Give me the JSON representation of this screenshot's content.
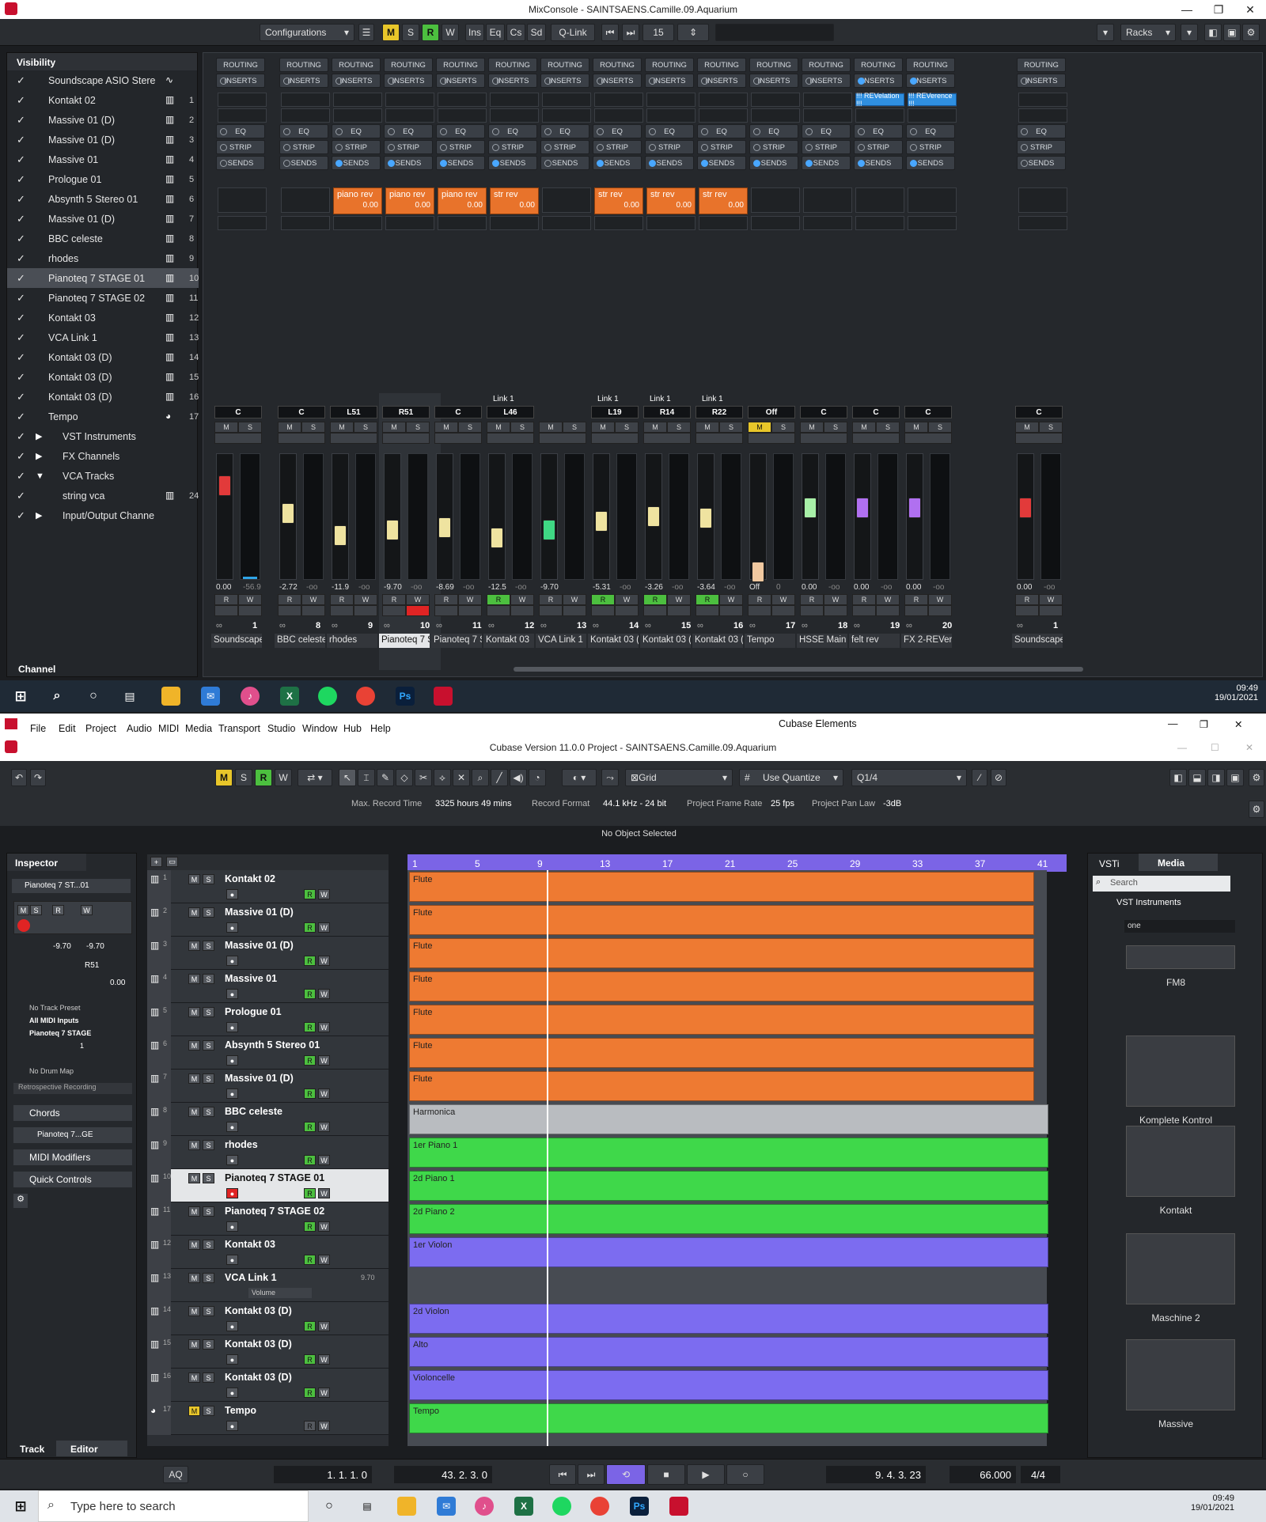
{
  "mixwin": {
    "title": "MixConsole - SAINTSAENS.Camille.09.Aquarium",
    "toolbar": {
      "configurations": "Configurations",
      "m": "M",
      "s": "S",
      "r": "R",
      "w": "W",
      "ins": "Ins",
      "eq": "Eq",
      "cs": "Cs",
      "sd": "Sd",
      "qlink": "Q-Link",
      "count": "15",
      "racks": "Racks"
    },
    "visibility_title": "Visibility",
    "channel_tab": "Channel",
    "visibility": [
      {
        "name": "Soundscape ASIO Stere",
        "num": ""
      },
      {
        "name": "Kontakt 02",
        "num": "1"
      },
      {
        "name": "Massive 01 (D)",
        "num": "2"
      },
      {
        "name": "Massive 01 (D)",
        "num": "3"
      },
      {
        "name": "Massive 01",
        "num": "4"
      },
      {
        "name": "Prologue 01",
        "num": "5"
      },
      {
        "name": "Absynth 5 Stereo 01",
        "num": "6"
      },
      {
        "name": "Massive 01 (D)",
        "num": "7"
      },
      {
        "name": "BBC celeste",
        "num": "8"
      },
      {
        "name": "rhodes",
        "num": "9"
      },
      {
        "name": "Pianoteq 7 STAGE 01",
        "num": "10"
      },
      {
        "name": "Pianoteq 7 STAGE 02",
        "num": "11"
      },
      {
        "name": "Kontakt 03",
        "num": "12"
      },
      {
        "name": "VCA Link 1",
        "num": "13"
      },
      {
        "name": "Kontakt 03 (D)",
        "num": "14"
      },
      {
        "name": "Kontakt 03 (D)",
        "num": "15"
      },
      {
        "name": "Kontakt 03 (D)",
        "num": "16"
      },
      {
        "name": "Tempo",
        "num": "17"
      },
      {
        "name": "VST Instruments",
        "num": ""
      },
      {
        "name": "FX Channels",
        "num": ""
      },
      {
        "name": "VCA Tracks",
        "num": ""
      },
      {
        "name": "string vca",
        "num": "24"
      },
      {
        "name": "Input/Output Channe",
        "num": ""
      }
    ],
    "rack_labels": {
      "routing": "ROUTING",
      "inserts": "INSERTS",
      "eq": "EQ",
      "strip": "STRIP",
      "sends": "SENDS"
    },
    "inserts_blue": [
      "!!! REVelation !!!",
      "!!! REVerence !!!"
    ],
    "sends": [
      {
        "name": "piano rev",
        "value": "0.00"
      },
      {
        "name": "piano rev",
        "value": "0.00"
      },
      {
        "name": "piano rev",
        "value": "0.00"
      },
      {
        "name": "str rev",
        "value": "0.00"
      },
      {
        "name": "str rev",
        "value": "0.00"
      },
      {
        "name": "str rev",
        "value": "0.00"
      },
      {
        "name": "str rev",
        "value": "0.00"
      }
    ],
    "channels": [
      {
        "name": "Soundscape /",
        "num": "1",
        "pan": "C",
        "vol": "0.00",
        "peak": "-56.9",
        "cap": "#e23a3a",
        "link": "",
        "level": 0.8
      },
      {
        "name": "BBC celeste",
        "num": "8",
        "pan": "C",
        "vol": "-2.72",
        "peak": "-oo",
        "cap": "#efe3a0",
        "link": "",
        "level": 0.55
      },
      {
        "name": "rhodes",
        "num": "9",
        "pan": "L51",
        "vol": "-11.9",
        "peak": "-oo",
        "cap": "#efe3a0",
        "link": "",
        "level": 0.35
      },
      {
        "name": "Pianoteq 7 S1",
        "num": "10",
        "pan": "R51",
        "vol": "-9.70",
        "peak": "-oo",
        "cap": "#efe3a0",
        "link": "",
        "level": 0.4
      },
      {
        "name": "Pianoteq 7 S1",
        "num": "11",
        "pan": "C",
        "vol": "-8.69",
        "peak": "-oo",
        "cap": "#efe3a0",
        "link": "",
        "level": 0.42
      },
      {
        "name": "Kontakt 03",
        "num": "12",
        "pan": "L46",
        "vol": "-12.5",
        "peak": "-oo",
        "cap": "#efe3a0",
        "link": "Link 1",
        "level": 0.33
      },
      {
        "name": "VCA Link 1",
        "num": "13",
        "pan": "",
        "vol": "-9.70",
        "peak": "",
        "cap": "#3fd884",
        "link": "",
        "level": 0.4
      },
      {
        "name": "Kontakt 03 (D",
        "num": "14",
        "pan": "L19",
        "vol": "-5.31",
        "peak": "-oo",
        "cap": "#efe3a0",
        "link": "Link 1",
        "level": 0.48
      },
      {
        "name": "Kontakt 03 (D",
        "num": "15",
        "pan": "R14",
        "vol": "-3.26",
        "peak": "-oo",
        "cap": "#efe3a0",
        "link": "Link 1",
        "level": 0.52
      },
      {
        "name": "Kontakt 03 (D",
        "num": "16",
        "pan": "R22",
        "vol": "-3.64",
        "peak": "-oo",
        "cap": "#efe3a0",
        "link": "Link 1",
        "level": 0.51
      },
      {
        "name": "Tempo",
        "num": "17",
        "pan": "Off",
        "vol": "Off",
        "peak": "0",
        "cap": "#f0c8a0",
        "link": "",
        "level": 0.02
      },
      {
        "name": "HSSE Main",
        "num": "18",
        "pan": "C",
        "vol": "0.00",
        "peak": "-oo",
        "cap": "#a8f0a8",
        "link": "",
        "level": 0.6
      },
      {
        "name": "felt rev",
        "num": "19",
        "pan": "C",
        "vol": "0.00",
        "peak": "-oo",
        "cap": "#b070f0",
        "link": "",
        "level": 0.6
      },
      {
        "name": "FX 2-REVeren",
        "num": "20",
        "pan": "C",
        "vol": "0.00",
        "peak": "-oo",
        "cap": "#b070f0",
        "link": "",
        "level": 0.6
      },
      {
        "name": "Soundscape /",
        "num": "1",
        "pan": "C",
        "vol": "0.00",
        "peak": "-oo",
        "cap": "#e23a3a",
        "link": "",
        "level": 0.6
      }
    ]
  },
  "taskbar1": {
    "time": "09:49",
    "date": "19/01/2021"
  },
  "cubase": {
    "menu": [
      "File",
      "Edit",
      "Project",
      "Audio",
      "MIDI",
      "Media",
      "Transport",
      "Studio",
      "Window",
      "Hub",
      "Help"
    ],
    "app_title": "Cubase Elements",
    "title": "Cubase Version 11.0.0 Project - SAINTSAENS.Camille.09.Aquarium",
    "grid": "Grid",
    "use_quantize": "Use Quantize",
    "quantize": "1/4",
    "info": {
      "max_rec_label": "Max. Record Time",
      "max_rec": "3325 hours 49 mins",
      "format_label": "Record Format",
      "format": "44.1 kHz - 24 bit",
      "frame_label": "Project Frame Rate",
      "frame": "25 fps",
      "pan_label": "Project Pan Law",
      "pan": "-3dB"
    },
    "no_object": "No Object Selected",
    "inspector": {
      "title": "Inspector",
      "track": "Pianoteq 7 ST...01",
      "vol": "-9.70",
      "pan": "R51",
      "sendval": "0.00",
      "preset": "No Track Preset",
      "input": "All MIDI Inputs",
      "output": "Pianoteq 7 STAGE",
      "channel": "1",
      "drum": "No Drum Map",
      "retro": "Retrospective Recording",
      "chords": "Chords",
      "pianoteq": "Pianoteq 7...GE",
      "midi_mod": "MIDI Modifiers",
      "quick": "Quick Controls",
      "tab_track": "Track",
      "tab_editor": "Editor"
    },
    "ruler": [
      "1",
      "5",
      "9",
      "13",
      "17",
      "21",
      "25",
      "29",
      "33",
      "37",
      "41"
    ],
    "tracks": [
      {
        "num": "1",
        "name": "Kontakt 02",
        "part": "Flute",
        "color": "orange"
      },
      {
        "num": "2",
        "name": "Massive 01 (D)",
        "part": "Flute",
        "color": "orange"
      },
      {
        "num": "3",
        "name": "Massive 01 (D)",
        "part": "Flute",
        "color": "orange"
      },
      {
        "num": "4",
        "name": "Massive 01",
        "part": "Flute",
        "color": "orange"
      },
      {
        "num": "5",
        "name": "Prologue 01",
        "part": "Flute",
        "color": "orange"
      },
      {
        "num": "6",
        "name": "Absynth 5 Stereo 01",
        "part": "Flute",
        "color": "orange"
      },
      {
        "num": "7",
        "name": "Massive 01 (D)",
        "part": "Flute",
        "color": "orange"
      },
      {
        "num": "8",
        "name": "BBC celeste",
        "part": "Harmonica",
        "color": "grey"
      },
      {
        "num": "9",
        "name": "rhodes",
        "part": "1er Piano 1",
        "color": "green"
      },
      {
        "num": "10",
        "name": "Pianoteq 7 STAGE 01",
        "part": "2d Piano 1",
        "color": "green"
      },
      {
        "num": "11",
        "name": "Pianoteq 7 STAGE 02",
        "part": "2d Piano 2",
        "color": "green"
      },
      {
        "num": "12",
        "name": "Kontakt 03",
        "part": "1er Violon",
        "color": "purple"
      },
      {
        "num": "13",
        "name": "VCA Link 1",
        "part": "",
        "color": "none",
        "extra": "Volume",
        "extraval": "9.70"
      },
      {
        "num": "14",
        "name": "Kontakt 03 (D)",
        "part": "2d Violon",
        "color": "purple"
      },
      {
        "num": "15",
        "name": "Kontakt 03 (D)",
        "part": "Alto",
        "color": "purple"
      },
      {
        "num": "16",
        "name": "Kontakt 03 (D)",
        "part": "Violoncelle",
        "color": "purple"
      },
      {
        "num": "17",
        "name": "Tempo",
        "part": "Tempo",
        "color": "green"
      }
    ],
    "media": {
      "tab_vsti": "VSTi",
      "tab_media": "Media",
      "search": "Search",
      "path": "VST Instruments",
      "filter": "one",
      "items": [
        "FM8",
        "Komplete Kontrol",
        "Kontakt",
        "Maschine 2",
        "Massive"
      ]
    },
    "transport": {
      "pos_left": "1. 1. 1.   0",
      "pos_right": "43. 2. 3.   0",
      "aq": "AQ",
      "position": "9. 4. 3. 23",
      "tempo": "66.000",
      "sig": "4/4"
    }
  },
  "taskbar2": {
    "search": "Type here to search",
    "time": "09:49",
    "date": "19/01/2021"
  }
}
